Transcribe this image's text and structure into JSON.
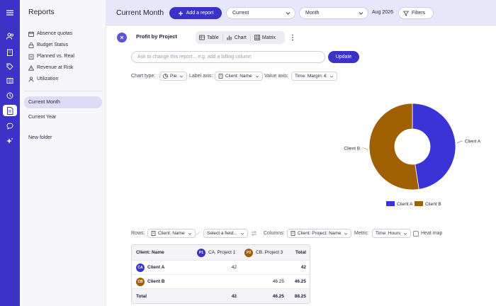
{
  "rail": {
    "icons": [
      "menu-icon",
      "users-icon",
      "building-icon",
      "tag-icon",
      "table-icon",
      "clock-icon",
      "report-icon",
      "chat-icon",
      "sparkle-icon"
    ]
  },
  "sidebar": {
    "title": "Reports",
    "items": [
      {
        "label": "Absence quotas",
        "icon": "calendar-icon"
      },
      {
        "label": "Budget Status",
        "icon": "lock-icon"
      },
      {
        "label": "Planned vs. Real",
        "icon": "clipboard-icon"
      },
      {
        "label": "Revenue at Risk",
        "icon": "warning-icon"
      },
      {
        "label": "Utilization",
        "icon": "person-icon"
      }
    ],
    "saved": [
      "Current Month",
      "Current Year"
    ],
    "new_folder": "New folder"
  },
  "header": {
    "title": "Current Month",
    "add_report": "Add a report",
    "range_select": "Current",
    "period_select": "Month",
    "period_label": "Aug 2026",
    "filters": "Filters"
  },
  "report": {
    "title": "Profit by Project",
    "views": [
      "Table",
      "Chart",
      "Matrix"
    ],
    "ask_placeholder": "Ask to change this report... e.g. add a billing column",
    "update": "Update",
    "chart_type_label": "Chart type:",
    "chart_type": "Pie",
    "label_axis_label": "Label axis:",
    "label_axis": "Client: Name",
    "value_axis_label": "Value axis:",
    "value_axis": "Time: Margin: €"
  },
  "chart_data": {
    "type": "pie",
    "categories": [
      "Client A",
      "Client B"
    ],
    "values": [
      42,
      46.25
    ],
    "colors": [
      "#3b33d6",
      "#a05f00"
    ],
    "donut": true,
    "legend": "bottom"
  },
  "matrix": {
    "rows_label": "Rows:",
    "rows_value": "Client: Name",
    "select_field": "Select a field...",
    "columns_label": "Columns:",
    "columns_value": "Client: Project: Name",
    "metric_label": "Metric:",
    "metric_value": "Time: Hours",
    "heat_map": "Heat map",
    "header": {
      "client": "Client: Name",
      "p1": "CA. Project 1",
      "p3": "CB. Project 3",
      "total": "Total"
    },
    "p1_badge": "P1",
    "p3_badge": "P3",
    "rows": [
      {
        "initials": "CA",
        "name": "Client A",
        "p1": "42",
        "p3": "",
        "total": "42",
        "color": "#3b33c7"
      },
      {
        "initials": "CB",
        "name": "Client B",
        "p1": "",
        "p3": "46.25",
        "total": "46.25",
        "color": "#a05f00"
      }
    ],
    "totals": {
      "label": "Total",
      "p1": "42",
      "p3": "46.25",
      "total": "88.25"
    }
  }
}
